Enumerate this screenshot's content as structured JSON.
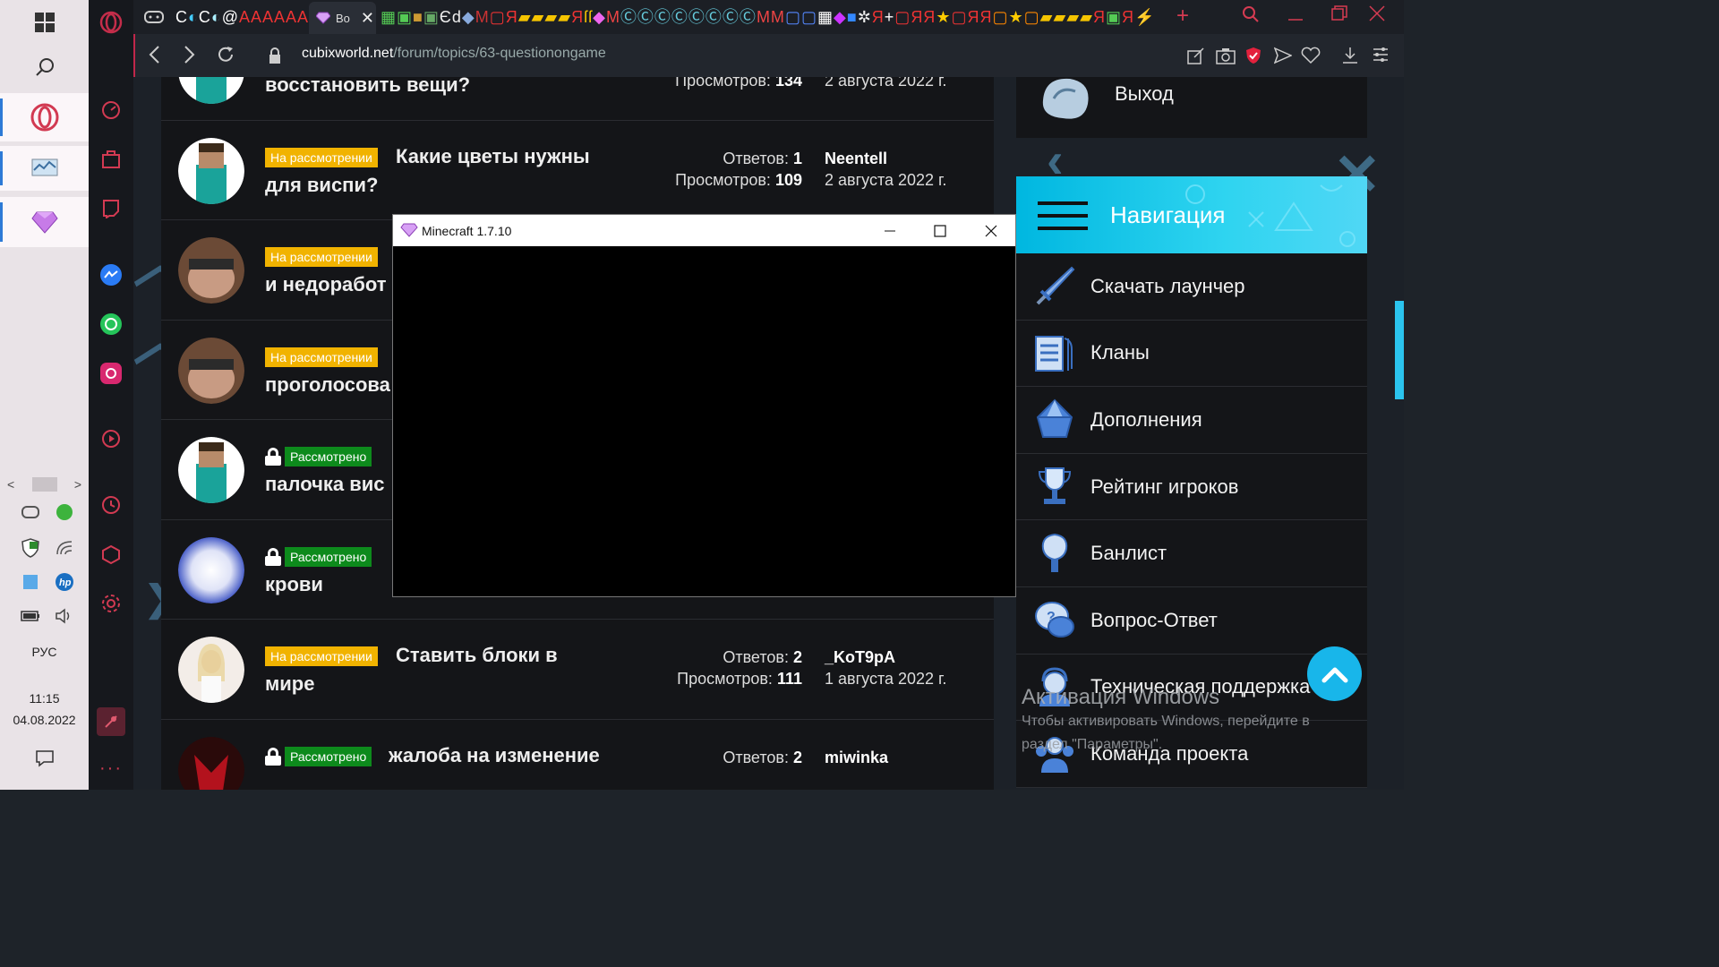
{
  "taskbar": {
    "language": "РУС",
    "time": "11:15",
    "date": "04.08.2022"
  },
  "browser": {
    "active_tab_title": "Bo",
    "url_domain": "cubixworld.net",
    "url_path": "/forum/topics/63-questionongame"
  },
  "topics": [
    {
      "title_line2": "восстановить вещи?",
      "views_label": "Просмотров:",
      "views": "134",
      "date": "2 августа 2022 г."
    },
    {
      "badge": "На рассмотрении",
      "badge_type": "w",
      "title_line1": "Какие цветы нужны",
      "title_line2": "для виспи?",
      "replies_label": "Ответов:",
      "replies": "1",
      "views_label": "Просмотров:",
      "views": "109",
      "author": "Neentell",
      "date": "2 августа 2022 г."
    },
    {
      "badge": "На рассмотрении",
      "badge_type": "w",
      "title_line2": "и недоработ"
    },
    {
      "badge": "На рассмотрении",
      "badge_type": "w",
      "title_line2": "проголосова"
    },
    {
      "badge": "Рассмотрено",
      "badge_type": "g",
      "locked": true,
      "title_line2": "палочка вис"
    },
    {
      "badge": "Рассмотрено",
      "badge_type": "g",
      "locked": true,
      "title_line2": "крови"
    },
    {
      "badge": "На рассмотрении",
      "badge_type": "w",
      "title_line1": "Ставить блоки в",
      "title_line2": "мире",
      "replies_label": "Ответов:",
      "replies": "2",
      "views_label": "Просмотров:",
      "views": "111",
      "author": "_KoT9pA",
      "date": "1 августа 2022 г."
    },
    {
      "badge": "Рассмотрено",
      "badge_type": "g",
      "locked": true,
      "title_line1": "жалоба на изменение",
      "replies_label": "Ответов:",
      "replies": "2",
      "author": "miwinka"
    }
  ],
  "sidebar": {
    "exit_label": "Выход",
    "nav_title": "Навигация",
    "items": [
      {
        "label": "Скачать лаунчер",
        "icon": "sword-icon"
      },
      {
        "label": "Кланы",
        "icon": "book-icon"
      },
      {
        "label": "Дополнения",
        "icon": "gem-icon"
      },
      {
        "label": "Рейтинг игроков",
        "icon": "trophy-icon"
      },
      {
        "label": "Банлист",
        "icon": "hammer-icon"
      },
      {
        "label": "Вопрос-Ответ",
        "icon": "speech-bubble-icon"
      },
      {
        "label": "Техническая поддержка",
        "icon": "support-icon"
      },
      {
        "label": "Команда проекта",
        "icon": "team-icon"
      }
    ]
  },
  "minecraft_window": {
    "title": "Minecraft 1.7.10"
  },
  "activation": {
    "heading": "Активация Windows",
    "text_line1": "Чтобы активировать Windows, перейдите в",
    "text_line2": "раздел \"Параметры\"."
  },
  "colors": {
    "accent_opera": "#d23a52",
    "nav_header": "#1cc4ea",
    "badge_pending": "#f1b300",
    "badge_done": "#0d8a1c"
  }
}
